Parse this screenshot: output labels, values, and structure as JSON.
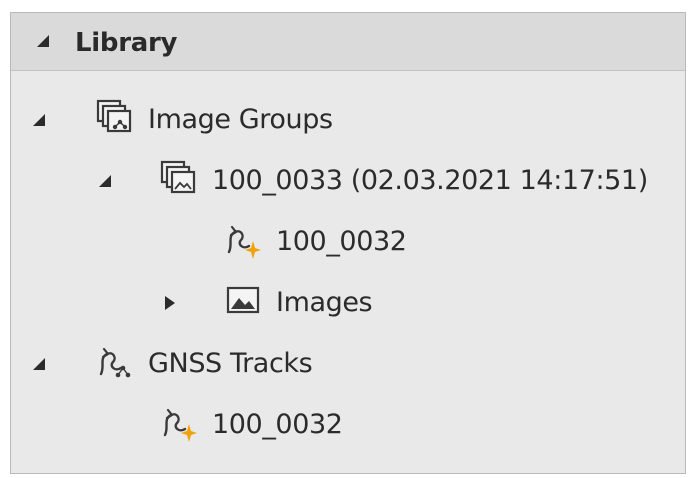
{
  "library": {
    "title": "Library",
    "tree": {
      "image_groups": {
        "label": "Image Groups",
        "icon": "image-groups-icon",
        "expanded": true
      },
      "group_100_0033": {
        "label": "100_0033 (02.03.2021 14:17:51)",
        "icon": "image-group-icon",
        "expanded": true
      },
      "group_track_100_0032": {
        "label": "100_0032",
        "icon": "gnss-track-icon"
      },
      "images": {
        "label": "Images",
        "icon": "images-icon",
        "expanded": false
      },
      "gnss_tracks": {
        "label": "GNSS Tracks",
        "icon": "gnss-tracks-icon",
        "expanded": true
      },
      "track_100_0032": {
        "label": "100_0032",
        "icon": "gnss-track-icon"
      }
    }
  },
  "colors": {
    "panel_bg": "#e9e9e9",
    "header_bg": "#dadada",
    "text": "#2b2b2b",
    "accent": "#f0a20a"
  }
}
